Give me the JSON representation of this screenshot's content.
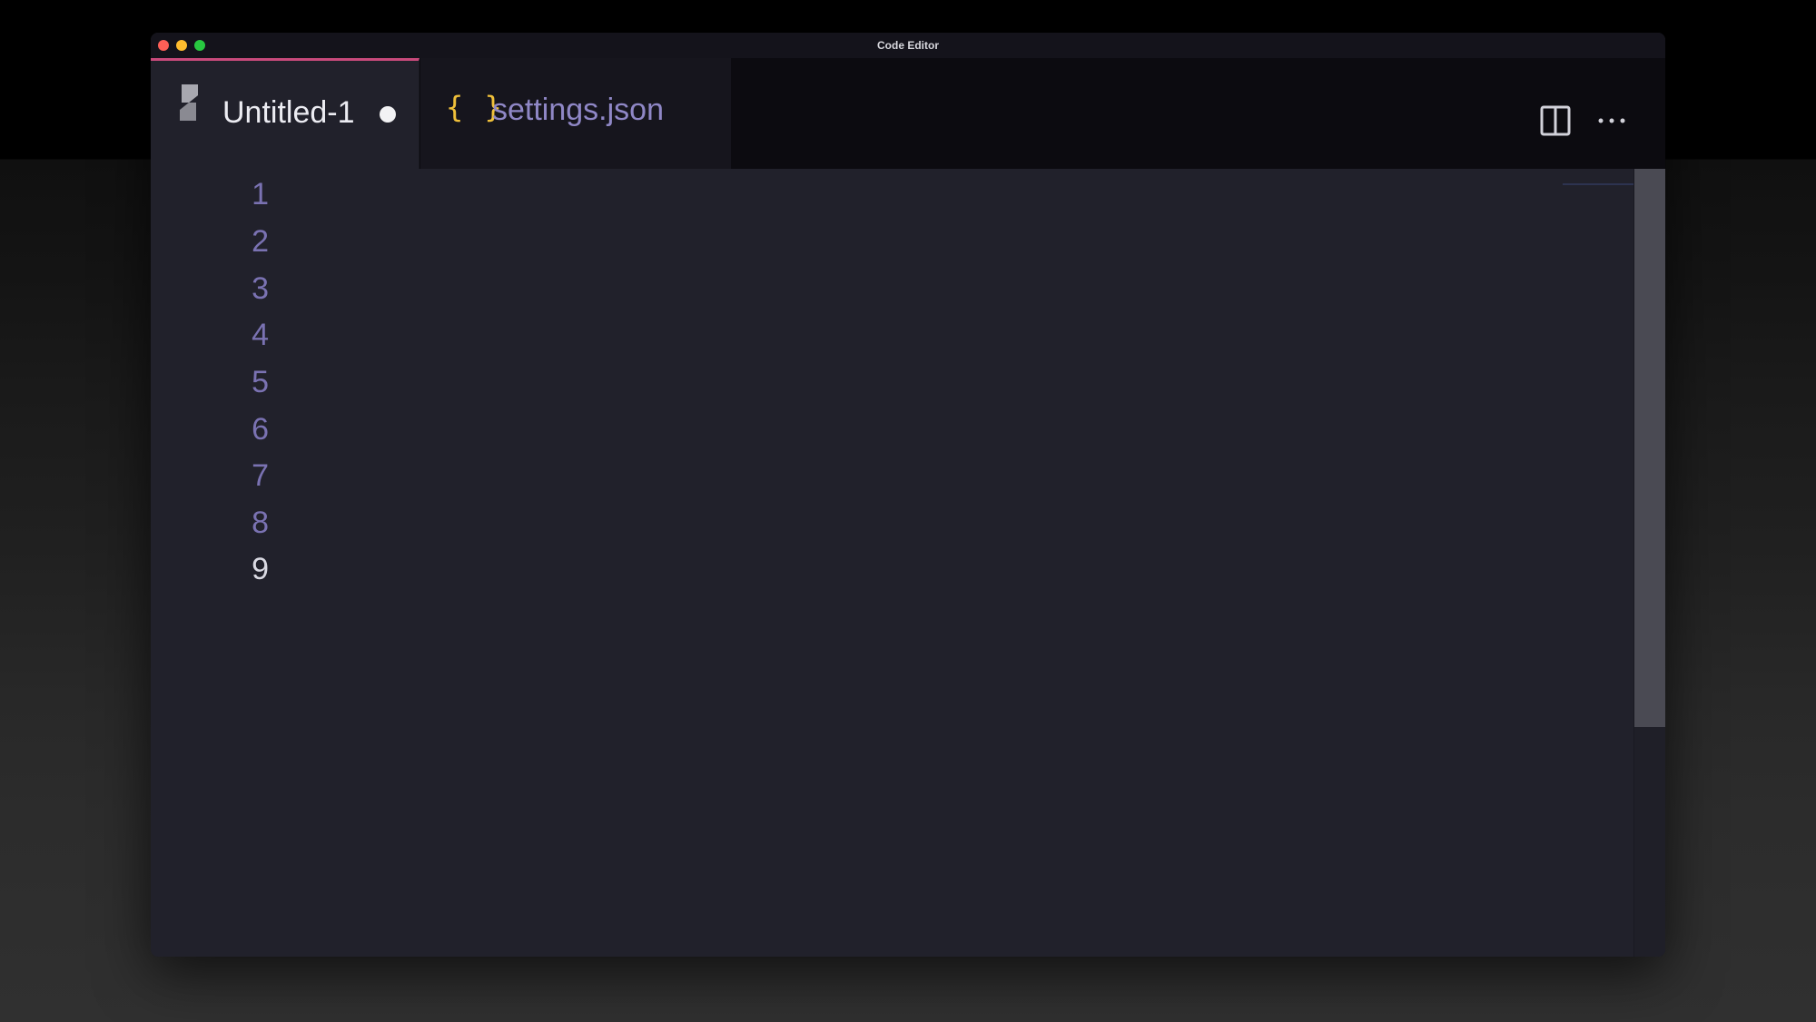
{
  "window": {
    "title": "Code Editor"
  },
  "tabs": [
    {
      "label": "Untitled-1",
      "icon": "swift-logo-icon",
      "active": true,
      "modified": true
    },
    {
      "label": "settings.json",
      "icon": "json-braces-icon",
      "icon_text": "{ }",
      "active": false,
      "modified": false
    }
  ],
  "toolbar": {
    "split_editor_icon": "split-editor-icon",
    "more_actions_icon": "more-actions-icon"
  },
  "editor": {
    "line_numbers": [
      "1",
      "2",
      "3",
      "4",
      "5",
      "6",
      "7",
      "8",
      "9"
    ],
    "current_line": "9"
  },
  "colors": {
    "editor_background": "#21212b",
    "tab_active_accent": "#c94a7c",
    "line_number": "#7a72b2",
    "json_icon": "#f0c03a",
    "inactive_tab_label": "#8f87c6"
  }
}
